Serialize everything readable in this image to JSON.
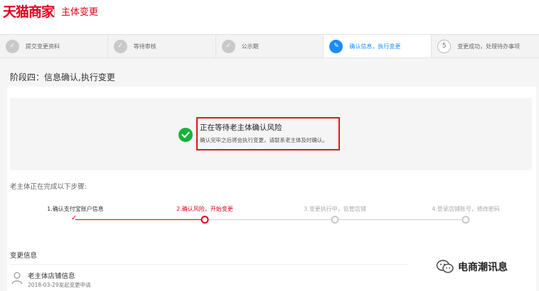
{
  "header": {
    "logo": "天猫商家",
    "title": "主体变更"
  },
  "steps": [
    {
      "label": "提交变更资料",
      "marker": "✓",
      "state": "done"
    },
    {
      "label": "等待审核",
      "marker": "✓",
      "state": "done"
    },
    {
      "label": "公示期",
      "marker": "✓",
      "state": "done"
    },
    {
      "label": "确认信息，执行变更",
      "marker": "✎",
      "state": "active"
    },
    {
      "label": "变更成功，处理待办事项",
      "marker": "5",
      "state": "todo"
    }
  ],
  "stage": {
    "title": "阶段四：信息确认,执行变更"
  },
  "status": {
    "title": "正在等待老主体确认风险",
    "description": "确认完毕之后将会执行变更，请联系老主体及时确认。",
    "icon": "check-circle-icon",
    "highlight_color": "#d9191c"
  },
  "progress": {
    "heading": "老主体正在完成以下步骤:",
    "steps": [
      {
        "label": "1.确认支付宝账户信息",
        "state": "done"
      },
      {
        "label": "2.确认风险，开始变更",
        "state": "current"
      },
      {
        "label": "3.变更执行中，监管店铺",
        "state": "todo"
      },
      {
        "label": "4.登录店铺账号，修改密码",
        "state": "todo"
      }
    ]
  },
  "change_info": {
    "title": "变更信息",
    "shop_name": "老主体店铺信息",
    "date": "2018-03-29发起变更申请"
  },
  "watermark": {
    "text": "电商潮讯息"
  },
  "colors": {
    "brand": "#e0001a",
    "active_blue": "#1a8cff",
    "success_green": "#19b13a"
  }
}
